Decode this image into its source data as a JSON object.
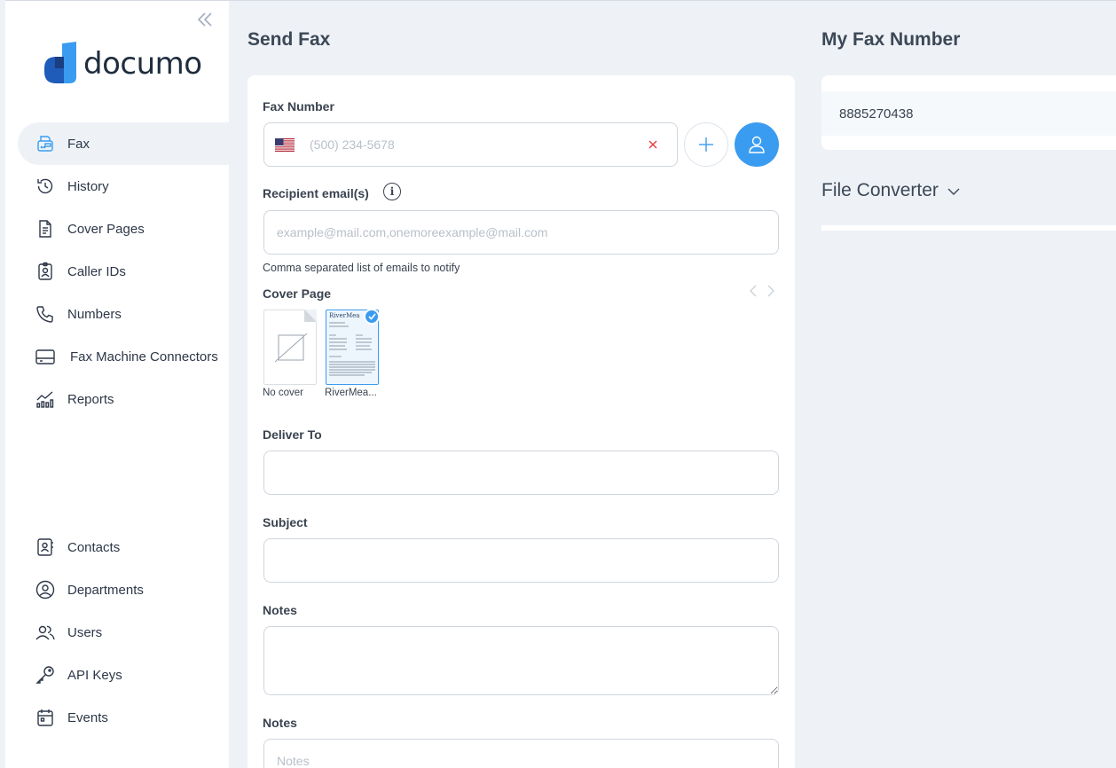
{
  "brand": {
    "name": "documo"
  },
  "sidebar": {
    "items": [
      {
        "label": "Fax",
        "icon": "fax-icon",
        "active": true
      },
      {
        "label": "History",
        "icon": "history-icon"
      },
      {
        "label": "Cover Pages",
        "icon": "document-icon"
      },
      {
        "label": "Caller IDs",
        "icon": "id-badge-icon"
      },
      {
        "label": "Numbers",
        "icon": "phone-icon"
      },
      {
        "label": "Fax Machine Connectors",
        "icon": "connector-icon"
      },
      {
        "label": "Reports",
        "icon": "reports-icon"
      }
    ],
    "bottom_items": [
      {
        "label": "Contacts",
        "icon": "contacts-icon"
      },
      {
        "label": "Departments",
        "icon": "departments-icon"
      },
      {
        "label": "Users",
        "icon": "users-icon"
      },
      {
        "label": "API Keys",
        "icon": "key-icon"
      },
      {
        "label": "Events",
        "icon": "calendar-icon"
      }
    ]
  },
  "send_fax": {
    "title": "Send Fax",
    "fax_number": {
      "label": "Fax Number",
      "placeholder": "(500) 234-5678"
    },
    "recipient_emails": {
      "label": "Recipient email(s)",
      "placeholder": "example@mail.com,onemoreexample@mail.com",
      "helper": "Comma separated list of emails to notify"
    },
    "cover_page": {
      "label": "Cover Page",
      "options": [
        {
          "label": "No cover",
          "selected": false
        },
        {
          "label": "RiverMea...",
          "thumb_text": "RiverMea",
          "selected": true
        }
      ]
    },
    "deliver_to": {
      "label": "Deliver To",
      "value": ""
    },
    "subject": {
      "label": "Subject",
      "value": ""
    },
    "notes": {
      "label": "Notes",
      "value": ""
    },
    "notes2": {
      "label": "Notes",
      "placeholder": "Notes"
    }
  },
  "my_fax_number": {
    "title": "My Fax Number",
    "value": "8885270438"
  },
  "file_converter": {
    "title": "File Converter"
  },
  "colors": {
    "accent": "#3a9cf0",
    "background": "#eef2f7",
    "clear": "#e53e3e"
  }
}
